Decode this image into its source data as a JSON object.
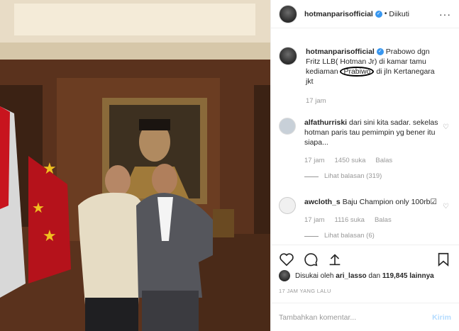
{
  "header": {
    "username": "hotmanparisofficial",
    "dot": "•",
    "follow_label": "Diikuti",
    "more_icon": "ellipsis-icon"
  },
  "caption": {
    "username": "hotmanparisofficial",
    "text_before": "Prabowo dgn Fritz LLB( Hotman Jr) di kamar tamu kediaman",
    "circled": "Prabiwo",
    "text_after": "di jln Kertanegara jkt",
    "time": "17 jam"
  },
  "comments": [
    {
      "username": "alfathurriski",
      "text": "dari sini kita sadar. sekelas hotman paris tau pemimpin yg bener itu siapa...",
      "time": "17 jam",
      "likes": "1450 suka",
      "reply": "Balas",
      "view_replies": "Lihat balasan (319)"
    },
    {
      "username": "awcloth_s",
      "text": "Baju Champion only 100rb☑",
      "time": "17 jam",
      "likes": "1116 suka",
      "reply": "Balas",
      "view_replies": "Lihat balasan (6)"
    }
  ],
  "likes": {
    "prefix": "Disukai oleh",
    "user": "ari_lasso",
    "conj": "dan",
    "count": "119,845 lainnya"
  },
  "date": "17 JAM YANG LALU",
  "comment_box": {
    "placeholder": "Tambahkan komentar...",
    "send_label": "Kirim"
  },
  "colors": {
    "accent": "#3897f0",
    "send_disabled": "#b3dbff"
  }
}
